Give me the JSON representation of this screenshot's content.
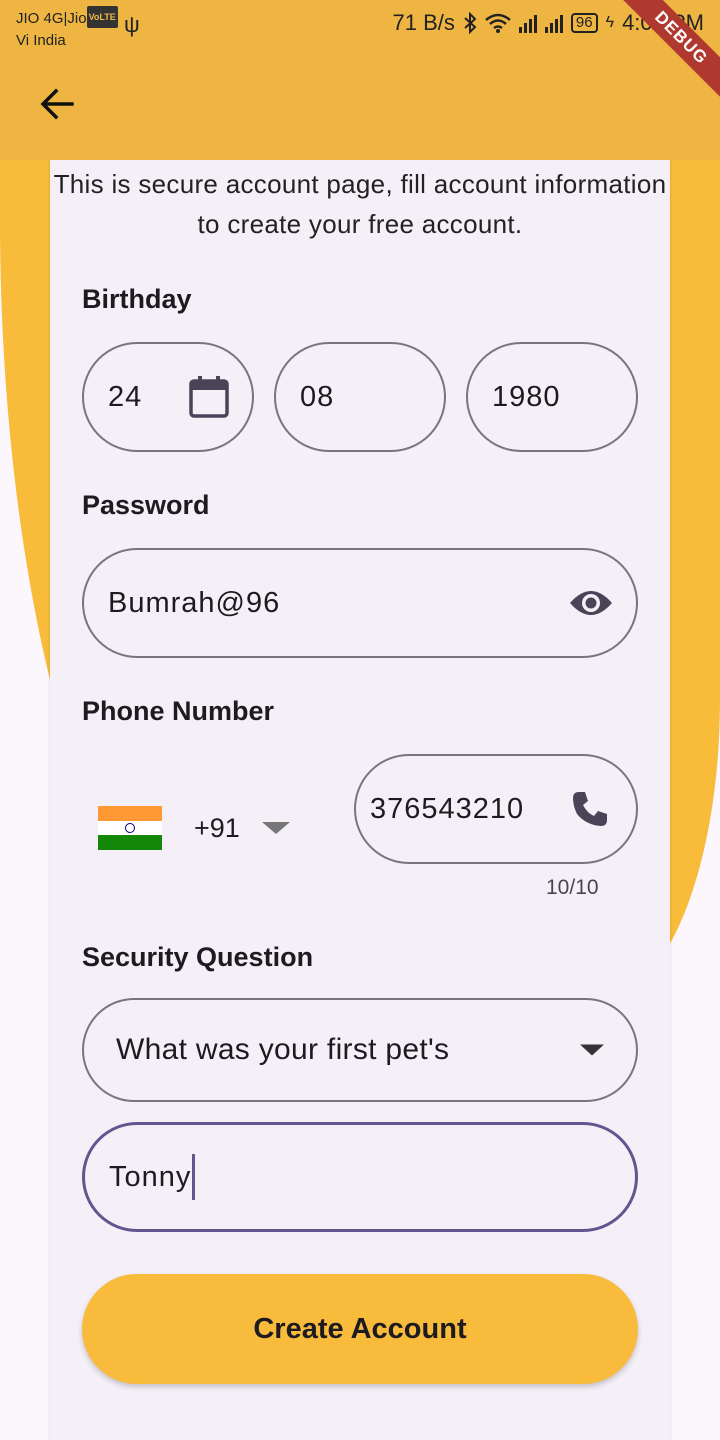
{
  "status_bar": {
    "carrier1": "JIO 4G|Jio",
    "volte_badge": "VoLTE",
    "carrier2": "Vi India",
    "net_speed": "71 B/s",
    "battery": "96",
    "time": "4:02 PM",
    "debug_banner": "DEBUG"
  },
  "intro_text": "This is secure account page, fill account information to create your free account.",
  "birthday": {
    "label": "Birthday",
    "day": "24",
    "month": "08",
    "year": "1980"
  },
  "password": {
    "label": "Password",
    "value": "Bumrah@96"
  },
  "phone": {
    "label": "Phone Number",
    "dial_code": "+91",
    "number": "376543210",
    "counter": "10/10"
  },
  "security": {
    "label": "Security Question",
    "question": "What was your first pet's",
    "answer": "Tonny"
  },
  "create_button": "Create Account",
  "colors": {
    "accent": "#f9bb3b",
    "appbar": "#eeb543",
    "focus": "#65558f",
    "card": "#f5f0f7"
  }
}
